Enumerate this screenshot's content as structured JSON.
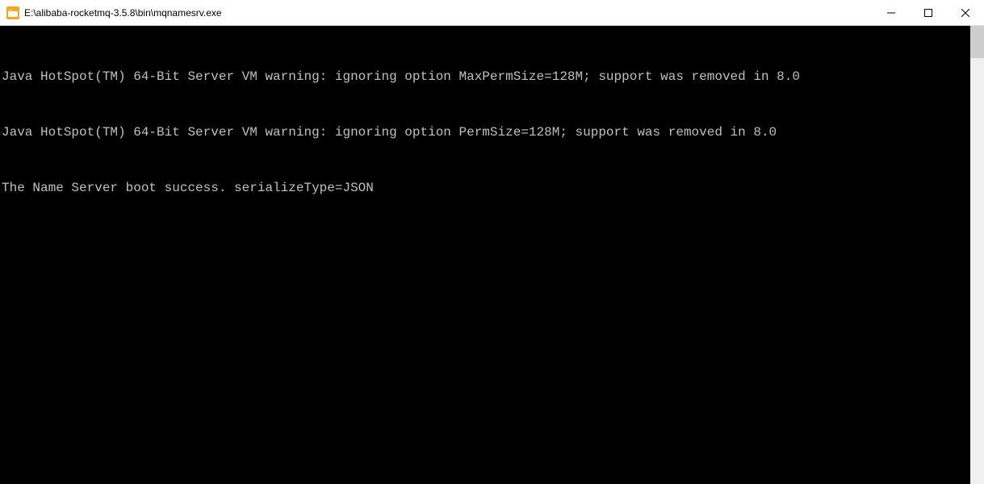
{
  "window": {
    "title": "E:\\alibaba-rocketmq-3.5.8\\bin\\mqnamesrv.exe",
    "icon_name": "console-app-icon"
  },
  "console": {
    "lines": [
      "Java HotSpot(TM) 64-Bit Server VM warning: ignoring option MaxPermSize=128M; support was removed in 8.0",
      "Java HotSpot(TM) 64-Bit Server VM warning: ignoring option PermSize=128M; support was removed in 8.0",
      "The Name Server boot success. serializeType=JSON"
    ]
  }
}
